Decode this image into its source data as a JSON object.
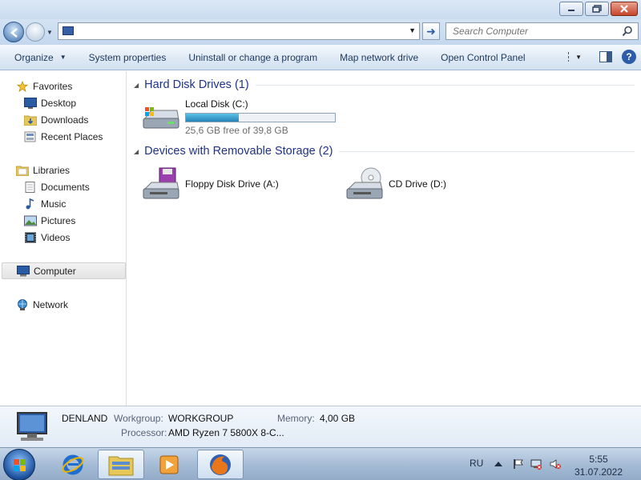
{
  "address": {
    "value": "",
    "search_placeholder": "Search Computer"
  },
  "toolbar": {
    "organize": "Organize",
    "system_properties": "System properties",
    "uninstall": "Uninstall or change a program",
    "map_network": "Map network drive",
    "open_control_panel": "Open Control Panel"
  },
  "nav": {
    "favorites": "Favorites",
    "desktop": "Desktop",
    "downloads": "Downloads",
    "recent_places": "Recent Places",
    "libraries": "Libraries",
    "documents": "Documents",
    "music": "Music",
    "pictures": "Pictures",
    "videos": "Videos",
    "computer": "Computer",
    "network": "Network"
  },
  "groups": {
    "hard_disks": "Hard Disk Drives (1)",
    "removable": "Devices with Removable Storage (2)"
  },
  "drives": {
    "local_disk": {
      "name": "Local Disk (C:)",
      "free_text": "25,6 GB free of 39,8 GB",
      "used_fraction": 0.357
    },
    "floppy": "Floppy Disk Drive (A:)",
    "cd": "CD Drive (D:)"
  },
  "details": {
    "computer_name": "DENLAND",
    "workgroup_label": "Workgroup:",
    "workgroup_value": "WORKGROUP",
    "memory_label": "Memory:",
    "memory_value": "4,00 GB",
    "processor_label": "Processor:",
    "processor_value": "AMD Ryzen 7 5800X 8-C..."
  },
  "taskbar": {
    "language": "RU",
    "time": "5:55",
    "date": "31.07.2022",
    "pinned": [
      "internet-explorer-icon",
      "windows-explorer-icon",
      "media-player-icon",
      "firefox-icon"
    ]
  },
  "colors": {
    "group_header": "#1e3287",
    "progress_fill": "#2683b8",
    "toolbar_text": "#1e395b"
  }
}
